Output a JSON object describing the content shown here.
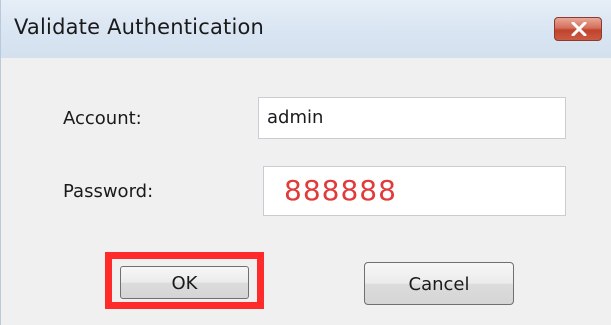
{
  "window": {
    "title": "Validate Authentication",
    "close_icon": "close-icon"
  },
  "form": {
    "account_label": "Account:",
    "account_value": "admin",
    "password_label": "Password:",
    "password_value": "888888",
    "password_value_color": "#e23a3a"
  },
  "buttons": {
    "ok_label": "OK",
    "cancel_label": "Cancel"
  },
  "highlight": {
    "color": "#ff2a2a"
  }
}
